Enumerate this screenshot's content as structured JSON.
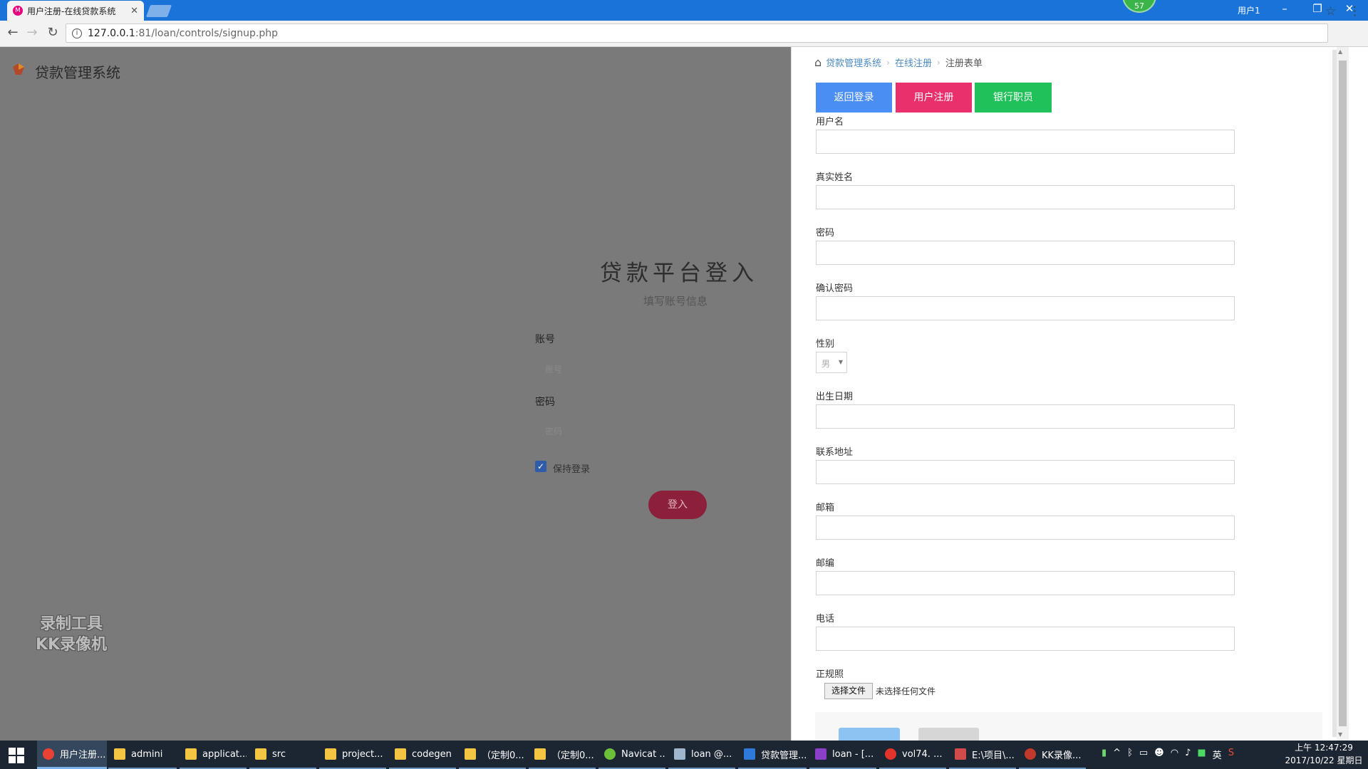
{
  "browser": {
    "tab_title": "用户注册-在线贷款系统",
    "tab_favicon": "M",
    "tab_close": "✕",
    "badge": "57",
    "window_user": "用户1",
    "url_host": "127.0.0.1",
    "url_rest": ":81/loan/controls/signup.php",
    "icons": {
      "back": "back-arrow-icon",
      "forward": "forward-arrow-icon",
      "reload": "reload-icon",
      "bookmark": "star-icon",
      "menu": "kebab-menu-icon"
    }
  },
  "login_panel": {
    "logo_text": "贷款管理系统",
    "title": "贷款平台登入",
    "subtitle": "填写账号信息",
    "account_label": "账号",
    "account_placeholder": "账号",
    "password_label": "密码",
    "password_placeholder": "密码",
    "keep_login": "保持登录",
    "keep_login_checked": true,
    "login_button": "登入",
    "watermark_line1": "录制工具",
    "watermark_line2": "KK录像机"
  },
  "breadcrumb": {
    "item1": "贷款管理系统",
    "item2": "在线注册",
    "item3": "注册表单"
  },
  "top_buttons": {
    "back": "返回登录",
    "user": "用户注册",
    "bank": "银行职员"
  },
  "form": {
    "username": "用户名",
    "realname": "真实姓名",
    "password": "密码",
    "confirm": "确认密码",
    "gender": "性别",
    "gender_value": "男",
    "birthday": "出生日期",
    "address": "联系地址",
    "email": "邮箱",
    "zipcode": "邮编",
    "phone": "电话",
    "photo": "正规照",
    "file_button": "选择文件",
    "file_status": "未选择任何文件"
  },
  "taskbar": {
    "items": [
      "用户注册...",
      "admini",
      "applicat...",
      "src",
      "project...",
      "codegen",
      "（定制0...",
      "（定制0...",
      "Navicat ...",
      "loan @...",
      "贷款管理...",
      "loan - [...",
      "vol74. ...",
      "E:\\项目\\...",
      "KK录像..."
    ],
    "ime": "英",
    "time": "上午 12:47:29",
    "date": "2017/10/22 星期日"
  },
  "colors": {
    "accent_blue": "#4a8ef3",
    "accent_pink": "#ea2f6d",
    "accent_green": "#20c15a",
    "login_button": "#8c1f3a"
  }
}
